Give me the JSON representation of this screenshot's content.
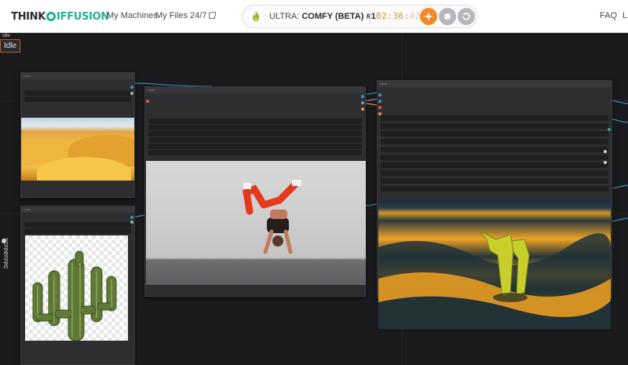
{
  "brand": {
    "logo_think": "THINK",
    "logo_rest": "IFFUSION",
    "accent": "#1fb28e"
  },
  "nav": {
    "machines": "My Machines",
    "files": "My Files 24/7",
    "faq": "FAQ",
    "more": "L"
  },
  "session": {
    "tier": "ULTRA: ",
    "name": "COMFY (BETA) #1",
    "timer_main": "02:36:",
    "timer_seconds": "42",
    "timer_color": "#e8862c",
    "boost_icon": "sparkle-icon",
    "stop_icon": "stop-icon",
    "restart_icon": "restart-icon"
  },
  "canvas": {
    "status_small": "Idle",
    "status": "Idle",
    "screenrec": "screenrec"
  },
  "nodes": {
    "source_image": {
      "title": "Load"
    },
    "cactus_image": {
      "title": "Load"
    },
    "pose_image": {
      "title": "Load"
    },
    "output_image": {
      "title": "Save"
    }
  }
}
